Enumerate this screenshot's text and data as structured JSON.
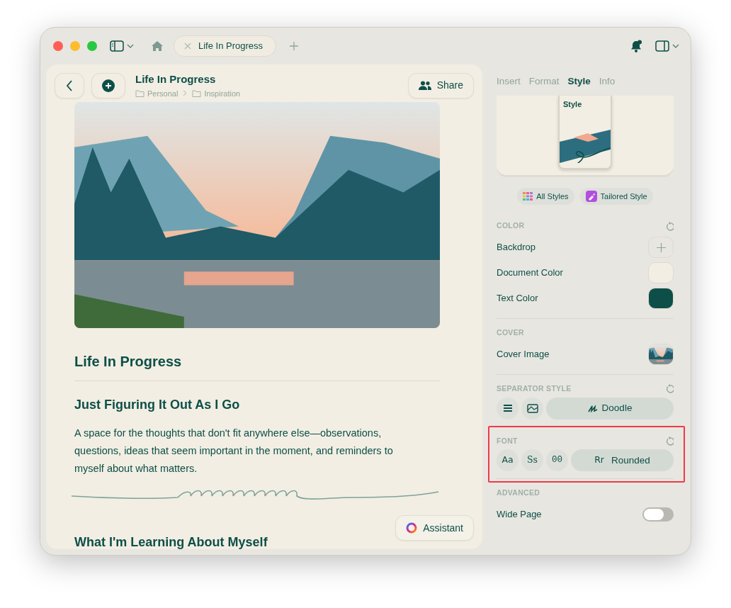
{
  "window": {
    "tabs": [
      {
        "label": "Life In Progress",
        "selected": true
      }
    ]
  },
  "document": {
    "title": "Life In Progress",
    "breadcrumb": [
      "Personal",
      "Inspiration"
    ],
    "share": "Share",
    "blocks": [
      {
        "kind": "image"
      },
      {
        "kind": "title",
        "text": "Life In Progress"
      },
      {
        "kind": "rule"
      },
      {
        "kind": "heading",
        "text": "Just Figuring It Out As I Go"
      },
      {
        "kind": "paragraph",
        "text": "A space for the thoughts that don't fit anywhere else—observations, questions, ideas that seem important in the moment, and reminders to myself about what matters."
      },
      {
        "kind": "doodle"
      },
      {
        "kind": "heading",
        "text": "What I'm Learning About Myself"
      }
    ],
    "assistant": "Assistant"
  },
  "inspector": {
    "tabs": [
      {
        "label": "Insert",
        "selected": false
      },
      {
        "label": "Format",
        "selected": false
      },
      {
        "label": "Style",
        "selected": true
      },
      {
        "label": "Info",
        "selected": false
      }
    ],
    "preview_text": "Style",
    "style_buttons": [
      {
        "kind": "grid",
        "label": "All Styles"
      },
      {
        "kind": "brush",
        "label": "Tailored Style"
      }
    ],
    "sections": [
      {
        "title": "COLOR",
        "resettable": true,
        "rows": [
          {
            "kind": "add",
            "label": "Backdrop"
          },
          {
            "kind": "swatch",
            "label": "Document Color",
            "color": "#f2eee3"
          },
          {
            "kind": "swatch",
            "label": "Text Color",
            "color": "#0d4f48"
          }
        ]
      },
      {
        "title": "COVER",
        "rows": [
          {
            "kind": "image",
            "label": "Cover Image"
          }
        ]
      },
      {
        "title": "SEPARATOR STYLE",
        "resettable": true,
        "options": [
          {
            "kind": "lines",
            "selected": false
          },
          {
            "kind": "picture",
            "selected": false
          },
          {
            "kind": "doodle",
            "label": "Doodle",
            "selected": true
          }
        ]
      },
      {
        "title": "FONT",
        "resettable": true,
        "highlighted": true,
        "options": [
          {
            "kind": "font",
            "sample": "Aa",
            "selected": false
          },
          {
            "kind": "font",
            "sample": "Ss",
            "selected": false
          },
          {
            "kind": "font",
            "sample": "00",
            "selected": false
          },
          {
            "kind": "font",
            "sample": "Rr",
            "label": "Rounded",
            "selected": true
          }
        ]
      },
      {
        "title": "ADVANCED",
        "rows": [
          {
            "kind": "toggle",
            "label": "Wide Page",
            "on": false
          }
        ]
      }
    ]
  }
}
